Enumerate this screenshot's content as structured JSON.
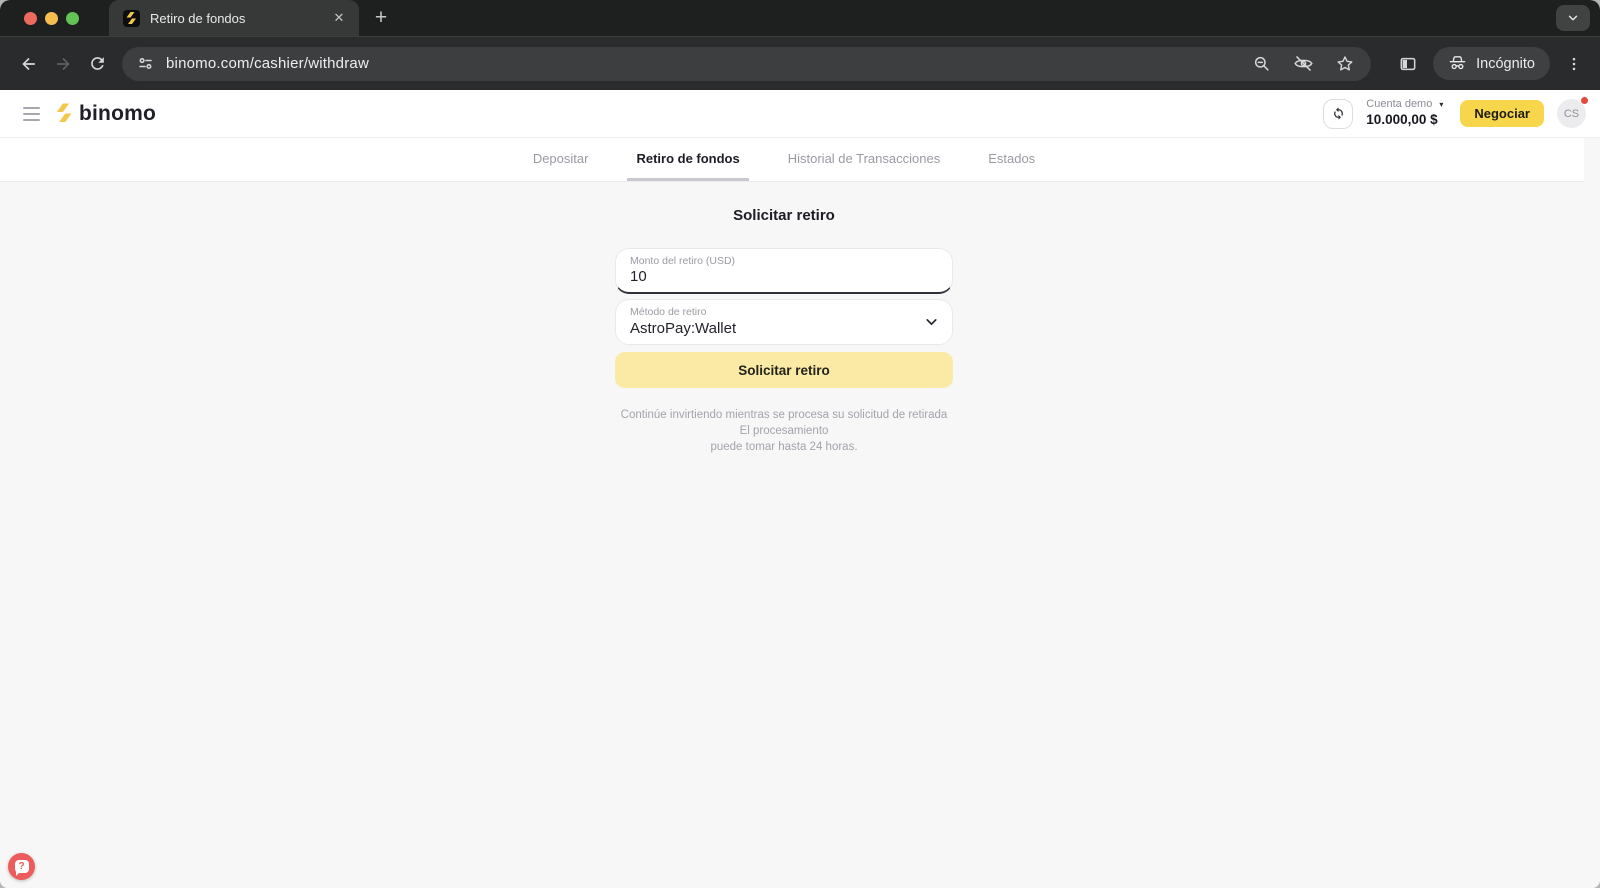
{
  "browser": {
    "tab_title": "Retiro de fondos",
    "url": "binomo.com/cashier/withdraw",
    "incognito_label": "Incógnito"
  },
  "icons": {
    "close_tab": "✕",
    "new_tab": "+",
    "account_caret": "▾",
    "help_question": "?"
  },
  "header": {
    "logo_text": "binomo",
    "account_type": "Cuenta demo",
    "balance": "10.000,00 $",
    "trade_button": "Negociar",
    "avatar_initials": "CS"
  },
  "cashier_tabs": {
    "items": [
      {
        "label": "Depositar",
        "active": false
      },
      {
        "label": "Retiro de fondos",
        "active": true
      },
      {
        "label": "Historial de Transacciones",
        "active": false
      },
      {
        "label": "Estados",
        "active": false
      }
    ]
  },
  "form": {
    "title": "Solicitar retiro",
    "amount": {
      "label": "Monto del retiro (USD)",
      "value": "10"
    },
    "method": {
      "label": "Método de retiro",
      "value": "AstroPay:Wallet"
    },
    "submit_label": "Solicitar retiro",
    "note_line1": "Continúe invirtiendo mientras se procesa su solicitud de retirada  El procesamiento",
    "note_line2": "puede tomar hasta 24 horas."
  },
  "colors": {
    "brand_yellow": "#f8d64b",
    "logo_yellow": "#f2c94c",
    "pale_yellow": "#fbe9a6",
    "help_red": "#ed5c5c",
    "notification_red": "#e8473c",
    "active_underline": "#c9c9d0"
  }
}
